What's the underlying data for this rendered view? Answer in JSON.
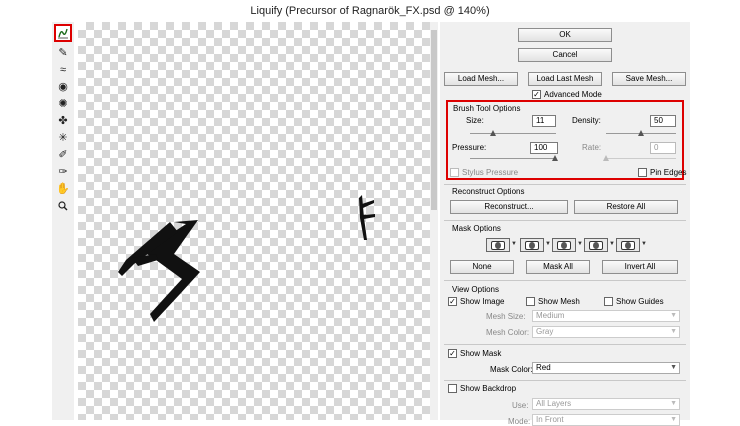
{
  "window": {
    "title": "Liquify (Precursor of Ragnarök_FX.psd @ 140%)"
  },
  "toolbar": {
    "tools": [
      {
        "name": "forward-warp-tool-icon",
        "glyph": "⌇",
        "active": true
      },
      {
        "name": "reconstruct-tool-icon",
        "glyph": "✎"
      },
      {
        "name": "smooth-tool-icon",
        "glyph": "≈"
      },
      {
        "name": "twirl-clockwise-tool-icon",
        "glyph": "◉"
      },
      {
        "name": "pucker-tool-icon",
        "glyph": "✺"
      },
      {
        "name": "bloat-tool-icon",
        "glyph": "✤"
      },
      {
        "name": "push-left-tool-icon",
        "glyph": "✳"
      },
      {
        "name": "freeze-mask-tool-icon",
        "glyph": "✐"
      },
      {
        "name": "thaw-mask-tool-icon",
        "glyph": "✑"
      },
      {
        "name": "hand-tool-icon",
        "glyph": "✋"
      },
      {
        "name": "zoom-tool-icon",
        "glyph": "🔍"
      }
    ]
  },
  "buttons": {
    "ok": "OK",
    "cancel": "Cancel",
    "load_mesh": "Load Mesh...",
    "load_last_mesh": "Load Last Mesh",
    "save_mesh": "Save Mesh..."
  },
  "advanced_mode": {
    "label": "Advanced Mode",
    "checked": true
  },
  "brush_tool_options": {
    "title": "Brush Tool Options",
    "size_label": "Size:",
    "size_value": "11",
    "density_label": "Density:",
    "density_value": "50",
    "pressure_label": "Pressure:",
    "pressure_value": "100",
    "rate_label": "Rate:",
    "rate_value": "0",
    "stylus_pressure": "Stylus Pressure",
    "pin_edges": "Pin Edges"
  },
  "reconstruct_options": {
    "title": "Reconstruct Options",
    "reconstruct": "Reconstruct...",
    "restore_all": "Restore All"
  },
  "mask_options": {
    "title": "Mask Options",
    "none": "None",
    "mask_all": "Mask All",
    "invert_all": "Invert All"
  },
  "view_options": {
    "title": "View Options",
    "show_image": "Show Image",
    "show_mesh": "Show Mesh",
    "show_guides": "Show Guides",
    "mesh_size_label": "Mesh Size:",
    "mesh_size_value": "Medium",
    "mesh_color_label": "Mesh Color:",
    "mesh_color_value": "Gray",
    "show_mask": "Show Mask",
    "mask_color_label": "Mask Color:",
    "mask_color_value": "Red",
    "show_backdrop": "Show Backdrop",
    "use_label": "Use:",
    "use_value": "All Layers",
    "mode_label": "Mode:",
    "mode_value": "In Front"
  },
  "colors": {
    "highlight": "#dd0000",
    "panel_bg": "#f0f0f0"
  }
}
